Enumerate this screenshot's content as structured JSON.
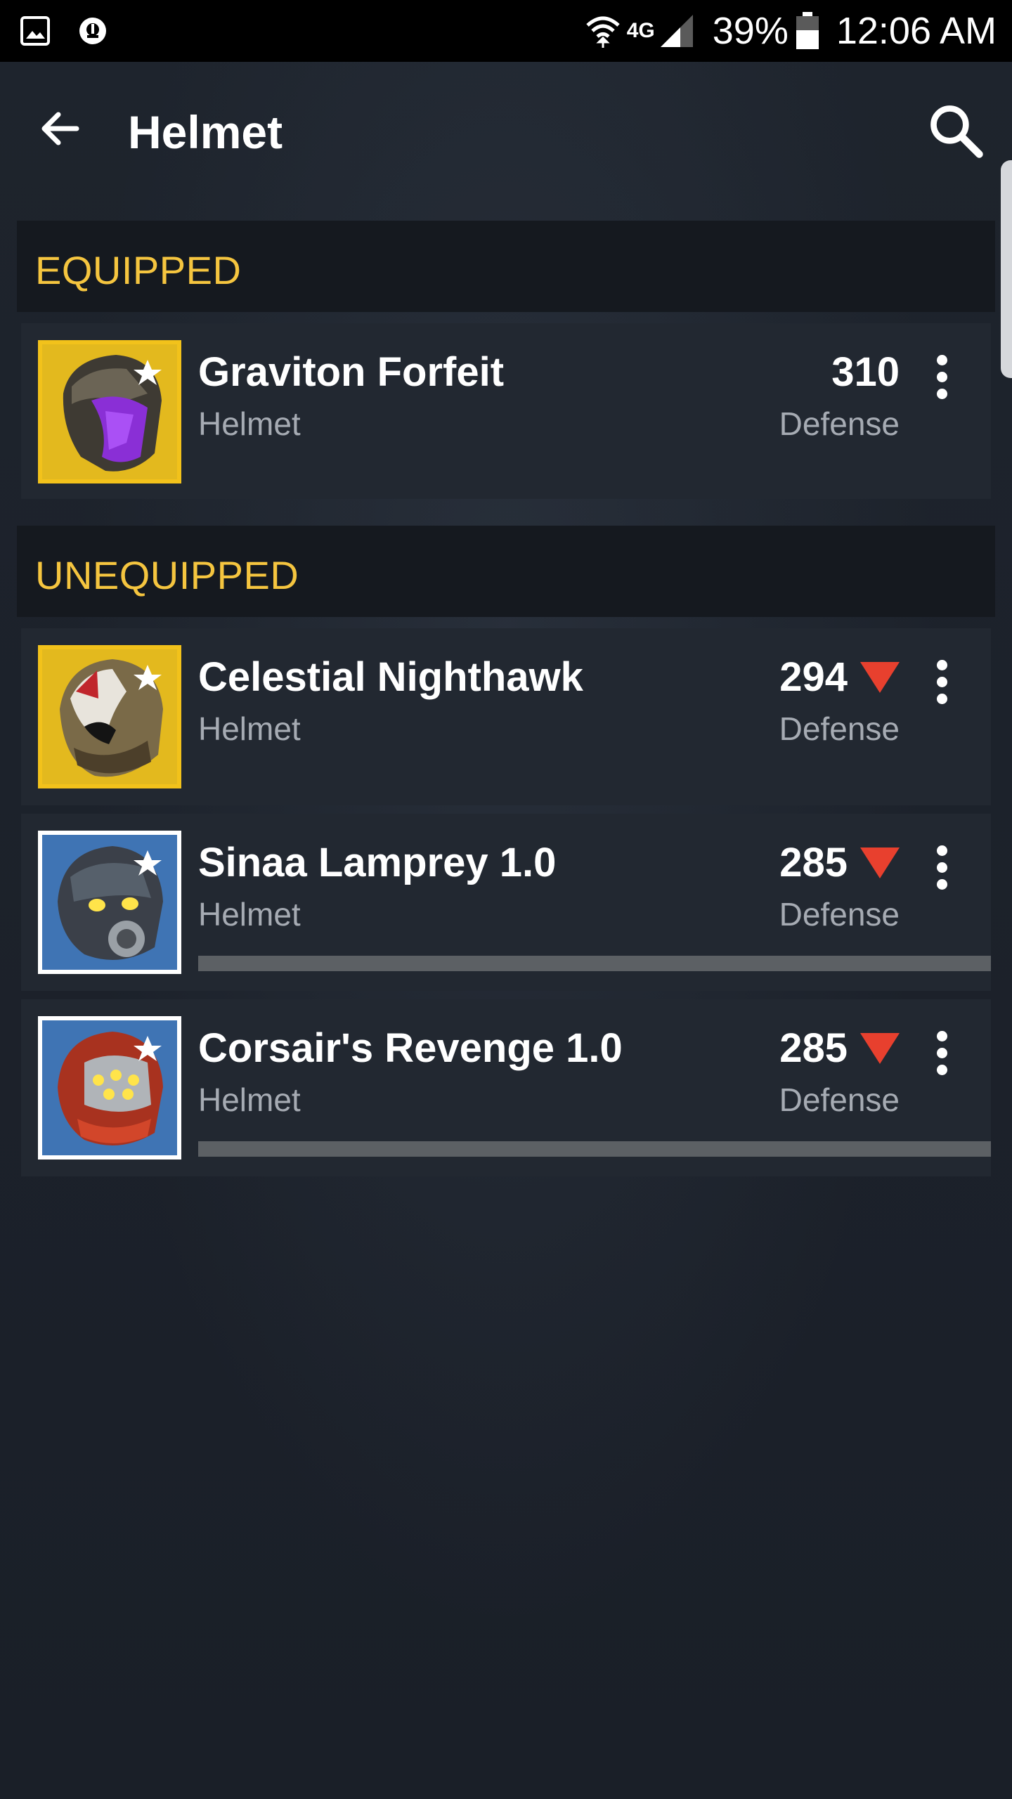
{
  "status_bar": {
    "network": "4G",
    "battery": "39%",
    "time": "12:06 AM",
    "icons": [
      "gallery-icon",
      "notification-app-icon",
      "wifi-icon",
      "network-4g-icon",
      "signal-icon",
      "battery-icon"
    ]
  },
  "app_bar": {
    "title": "Helmet",
    "back_icon": "back-arrow-icon",
    "search_icon": "search-icon"
  },
  "sections": {
    "equipped": {
      "header": "EQUIPPED",
      "items": [
        {
          "name": "Graviton Forfeit",
          "type": "Helmet",
          "stat": "310",
          "stat_label": "Defense",
          "tier": "exotic",
          "border_color": "#f2c21b",
          "lower_than_equipped": false
        }
      ]
    },
    "unequipped": {
      "header": "UNEQUIPPED",
      "items": [
        {
          "name": "Celestial Nighthawk",
          "type": "Helmet",
          "stat": "294",
          "stat_label": "Defense",
          "tier": "exotic",
          "border_color": "#f2c21b",
          "lower_than_equipped": true
        },
        {
          "name": "Sinaa Lamprey 1.0",
          "type": "Helmet",
          "stat": "285",
          "stat_label": "Defense",
          "tier": "legendary",
          "border_color": "#ffffff",
          "lower_than_equipped": true,
          "progress": 0
        },
        {
          "name": "Corsair's Revenge 1.0",
          "type": "Helmet",
          "stat": "285",
          "stat_label": "Defense",
          "tier": "legendary",
          "border_color": "#ffffff",
          "lower_than_equipped": true,
          "progress": 0
        }
      ]
    }
  },
  "colors": {
    "section_header_text": "#f5c53f",
    "stat_down_arrow": "#e8402e",
    "background": "#1b2029"
  }
}
